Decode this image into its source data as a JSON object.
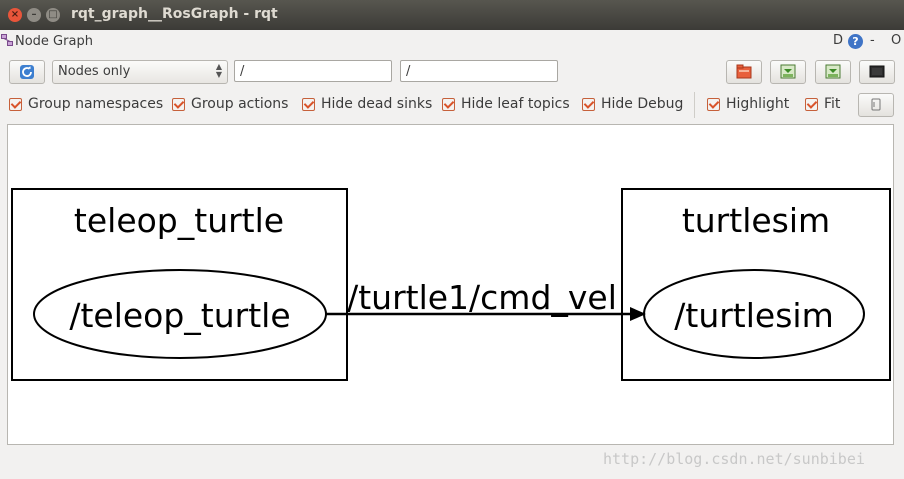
{
  "window": {
    "title": "rqt_graph__RosGraph - rqt",
    "controls": {
      "close": "×",
      "minimize": "–",
      "maximize": "□"
    }
  },
  "plugin": {
    "title": "Node Graph",
    "header_d": "D",
    "header_help": "?",
    "header_min": "-",
    "header_close": "O"
  },
  "toolbar": {
    "refresh_icon": "refresh-icon",
    "mode_selected": "Nodes only",
    "node_filter": "/",
    "topic_filter": "/"
  },
  "options": [
    {
      "label": "Group namespaces",
      "checked": true
    },
    {
      "label": "Group actions",
      "checked": true
    },
    {
      "label": "Hide dead sinks",
      "checked": true
    },
    {
      "label": "Hide leaf topics",
      "checked": true
    },
    {
      "label": "Hide Debug",
      "checked": true
    },
    {
      "label": "Highlight",
      "checked": true
    },
    {
      "label": "Fit",
      "checked": true
    }
  ],
  "graph": {
    "clusters": [
      {
        "name": "teleop_turtle",
        "node": "/teleop_turtle"
      },
      {
        "name": "turtlesim",
        "node": "/turtlesim"
      }
    ],
    "edge_label": "/turtle1/cmd_vel"
  },
  "watermark": "http://blog.csdn.net/sunbibei",
  "colors": {
    "accent": "#d9542b",
    "titlebar": "#3c3b37",
    "canvas": "#ffffff"
  }
}
